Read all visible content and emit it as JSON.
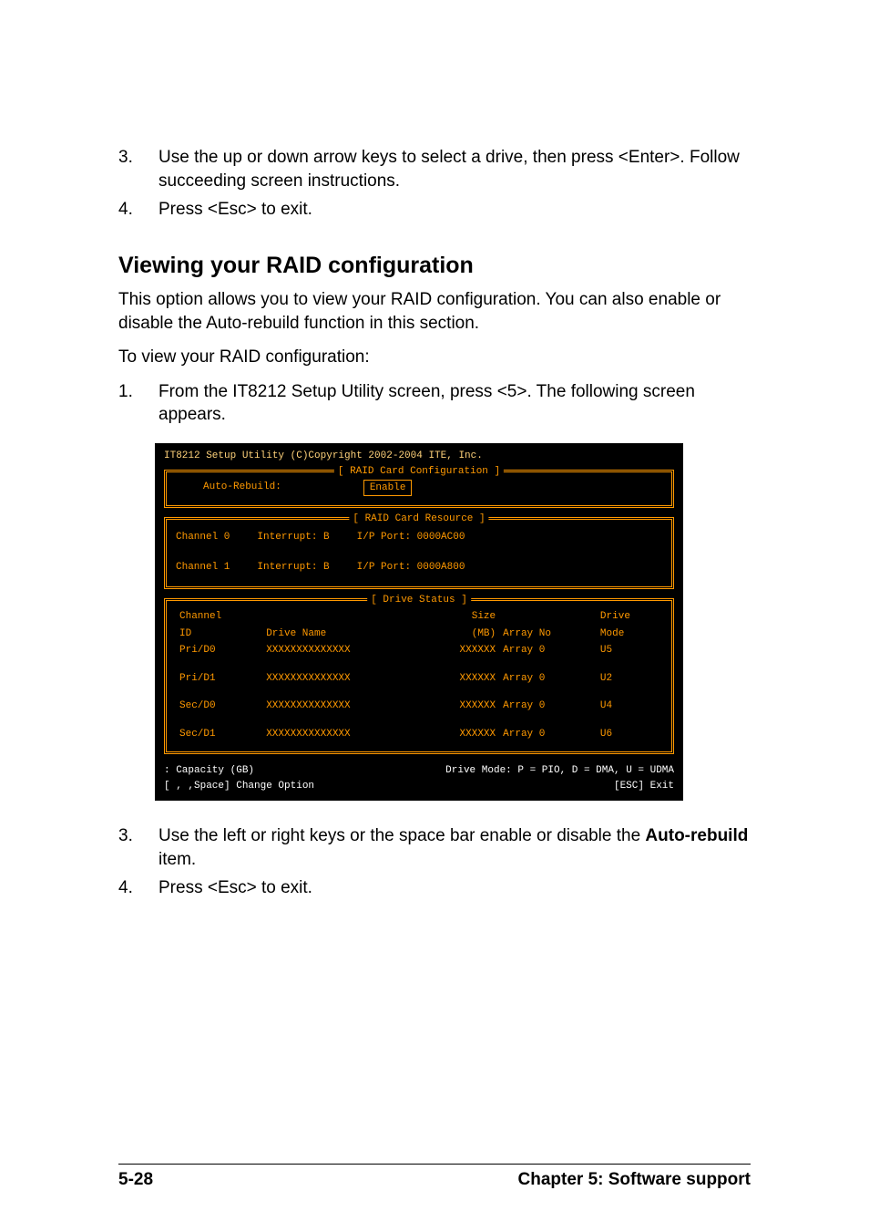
{
  "intro_list_a": {
    "items": [
      {
        "num": "3.",
        "text": "Use the up or down arrow keys to select a drive, then press <Enter>. Follow succeeding screen instructions."
      },
      {
        "num": "4.",
        "text": "Press <Esc> to exit."
      }
    ]
  },
  "section": {
    "heading": "Viewing your RAID configuration",
    "p1": "This option allows you to view your RAID configuration. You can also enable or disable the Auto-rebuild function in this section.",
    "p2": "To view your RAID configuration:"
  },
  "steps_b": {
    "items": [
      {
        "num": "1.",
        "text": "From the IT8212 Setup Utility screen, press <5>. The following screen appears."
      }
    ]
  },
  "terminal": {
    "title": "IT8212 Setup Utility (C)Copyright 2002-2004 ITE, Inc.",
    "raidCardConfig": {
      "boxTitle": "[ RAID Card Configuration ]",
      "autoRebuildLabel": "Auto-Rebuild:",
      "autoRebuildValue": "Enable"
    },
    "raidCardResource": {
      "boxTitle": "[ RAID Card Resource ]",
      "rows": [
        {
          "channel": "Channel 0",
          "interrupt": "Interrupt: B",
          "port": "I/P Port: 0000AC00"
        },
        {
          "channel": "Channel 1",
          "interrupt": "Interrupt: B",
          "port": "I/P Port: 0000A800"
        }
      ]
    },
    "driveStatus": {
      "boxTitle": "[ Drive Status ]",
      "headers": {
        "channelId1": "Channel",
        "channelId2": "ID",
        "driveName": "Drive Name",
        "size1": "Size",
        "size2": "(MB)",
        "arrayNo": "Array No",
        "driveMode1": "Drive",
        "driveMode2": "Mode"
      },
      "rows": [
        {
          "id": "Pri/D0",
          "name": "XXXXXXXXXXXXXX",
          "size": "XXXXXX",
          "array": "Array 0",
          "mode": "U5"
        },
        {
          "id": "Pri/D1",
          "name": "XXXXXXXXXXXXXX",
          "size": "XXXXXX",
          "array": "Array 0",
          "mode": "U2"
        },
        {
          "id": "Sec/D0",
          "name": "XXXXXXXXXXXXXX",
          "size": "XXXXXX",
          "array": "Array 0",
          "mode": "U4"
        },
        {
          "id": "Sec/D1",
          "name": "XXXXXXXXXXXXXX",
          "size": "XXXXXX",
          "array": "Array 0",
          "mode": "U6"
        }
      ]
    },
    "footer": {
      "capacity": ": Capacity (GB)",
      "driveMode": "Drive Mode: P = PIO, D = DMA, U = UDMA",
      "changeOption": "[ , ,Space] Change Option",
      "escExit": "[ESC] Exit"
    }
  },
  "steps_c": {
    "items": [
      {
        "num": "3.",
        "pre": "Use the left or right keys or the space bar enable or disable the ",
        "bold": "Auto-rebuild",
        "post": " item."
      },
      {
        "num": "4.",
        "pre": "Press <Esc> to exit.",
        "bold": "",
        "post": ""
      }
    ]
  },
  "footer": {
    "pageNum": "5-28",
    "chapter": "Chapter 5: Software support"
  }
}
